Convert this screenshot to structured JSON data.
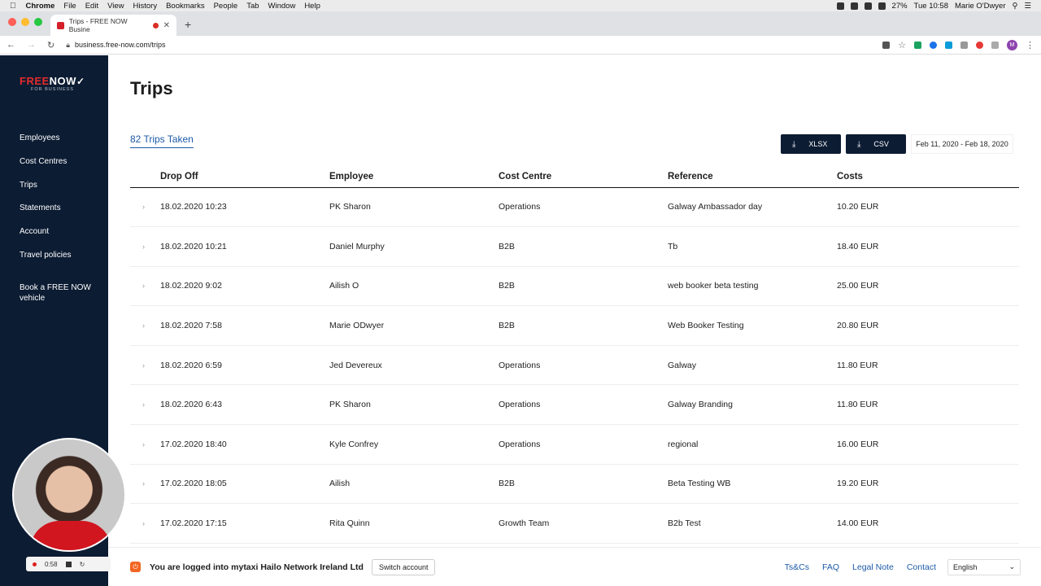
{
  "os_menu": {
    "app": "Chrome",
    "items": [
      "File",
      "Edit",
      "View",
      "History",
      "Bookmarks",
      "People",
      "Tab",
      "Window",
      "Help"
    ],
    "battery": "27%",
    "clock": "Tue 10:58",
    "user": "Marie O'Dwyer"
  },
  "browser": {
    "tab_title": "Trips - FREE NOW Busine",
    "url": "business.free-now.com/trips",
    "profile_initial": "M"
  },
  "sidebar": {
    "logo_text_a": "FREE",
    "logo_text_b": "NOW",
    "logo_sub": "FOR BUSINESS",
    "items": [
      {
        "label": "Employees"
      },
      {
        "label": "Cost Centres"
      },
      {
        "label": "Trips"
      },
      {
        "label": "Statements"
      },
      {
        "label": "Account"
      },
      {
        "label": "Travel policies"
      }
    ],
    "book_label": "Book a FREE NOW vehicle"
  },
  "main": {
    "title": "Trips",
    "trips_count": "82 Trips Taken",
    "xlsx_label": "XLSX",
    "csv_label": "CSV",
    "date_range": "Feb 11, 2020 - Feb 18, 2020"
  },
  "table": {
    "columns": [
      "Drop Off",
      "Employee",
      "Cost Centre",
      "Reference",
      "Costs"
    ],
    "rows": [
      [
        "18.02.2020 10:23",
        "PK Sharon",
        "Operations",
        "Galway Ambassador day",
        "10.20 EUR"
      ],
      [
        "18.02.2020 10:21",
        "Daniel Murphy",
        "B2B",
        "Tb",
        "18.40 EUR"
      ],
      [
        "18.02.2020 9:02",
        "Ailish O",
        "B2B",
        "web booker beta testing",
        "25.00 EUR"
      ],
      [
        "18.02.2020 7:58",
        "Marie ODwyer",
        "B2B",
        "Web Booker Testing",
        "20.80 EUR"
      ],
      [
        "18.02.2020 6:59",
        "Jed Devereux",
        "Operations",
        "Galway",
        "11.80 EUR"
      ],
      [
        "18.02.2020 6:43",
        "PK Sharon",
        "Operations",
        "Galway Branding",
        "11.80 EUR"
      ],
      [
        "17.02.2020 18:40",
        "Kyle Confrey",
        "Operations",
        "regional",
        "16.00 EUR"
      ],
      [
        "17.02.2020 18:05",
        "Ailish",
        "B2B",
        "Beta Testing WB",
        "19.20 EUR"
      ],
      [
        "17.02.2020 17:15",
        "Rita Quinn",
        "Growth Team",
        "B2b Test",
        "14.00 EUR"
      ]
    ]
  },
  "footer": {
    "logged_in": "You are logged into mytaxi Hailo Network Ireland Ltd",
    "switch_label": "Switch account",
    "links": [
      "Ts&Cs",
      "FAQ",
      "Legal Note",
      "Contact"
    ],
    "language": "English"
  },
  "recorder": {
    "time": "0:58"
  }
}
